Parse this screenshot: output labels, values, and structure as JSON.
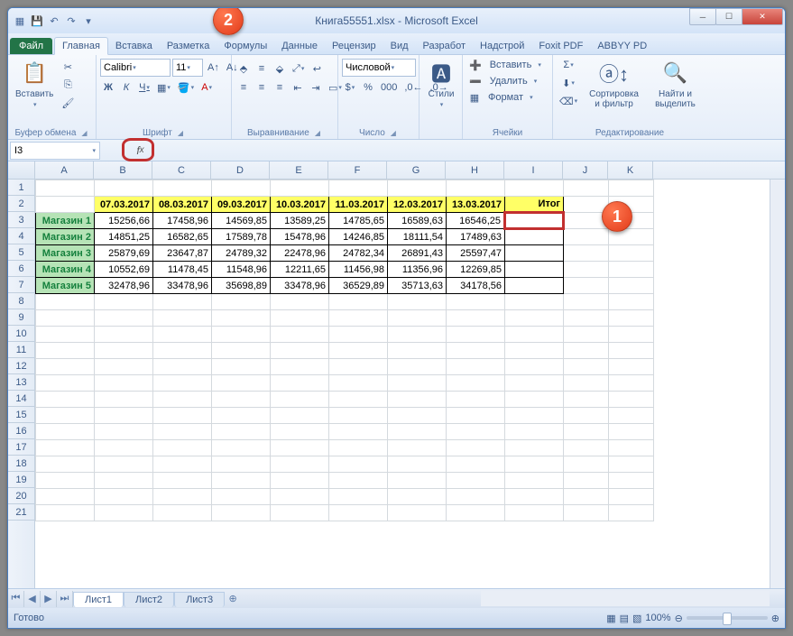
{
  "title": "Книга55551.xlsx - Microsoft Excel",
  "tabs": {
    "file": "Файл",
    "home": "Главная",
    "insert": "Вставка",
    "layout": "Разметка",
    "formulas": "Формулы",
    "data": "Данные",
    "review": "Рецензир",
    "view": "Вид",
    "dev": "Разработ",
    "addins": "Надстрой",
    "foxit": "Foxit PDF",
    "abbyy": "ABBYY PD"
  },
  "groups": {
    "clipboard": "Буфер обмена",
    "font": "Шрифт",
    "align": "Выравнивание",
    "number": "Число",
    "styles": "Стили",
    "cells": "Ячейки",
    "editing": "Редактирование"
  },
  "ribbon": {
    "paste": "Вставить",
    "font_name": "Calibri",
    "font_size": "11",
    "number_format": "Числовой",
    "insert": "Вставить",
    "delete": "Удалить",
    "format": "Формат",
    "styles": "Стили",
    "sort": "Сортировка и фильтр",
    "find": "Найти и выделить"
  },
  "namebox": "I3",
  "cols": [
    "A",
    "B",
    "C",
    "D",
    "E",
    "F",
    "G",
    "H",
    "I",
    "J",
    "K"
  ],
  "rows": [
    "1",
    "2",
    "3",
    "4",
    "5",
    "6",
    "7",
    "8",
    "9",
    "10",
    "11",
    "12",
    "13",
    "14",
    "15",
    "16",
    "17",
    "18",
    "19",
    "20",
    "21"
  ],
  "table": {
    "headers": [
      "07.03.2017",
      "08.03.2017",
      "09.03.2017",
      "10.03.2017",
      "11.03.2017",
      "12.03.2017",
      "13.03.2017",
      "Итог"
    ],
    "rows": [
      {
        "label": "Магазин 1",
        "v": [
          "15256,66",
          "17458,96",
          "14569,85",
          "13589,25",
          "14785,65",
          "16589,63",
          "16546,25"
        ]
      },
      {
        "label": "Магазин 2",
        "v": [
          "14851,25",
          "16582,65",
          "17589,78",
          "15478,96",
          "14246,85",
          "18111,54",
          "17489,63"
        ]
      },
      {
        "label": "Магазин 3",
        "v": [
          "25879,69",
          "23647,87",
          "24789,32",
          "22478,96",
          "24782,34",
          "26891,43",
          "25597,47"
        ]
      },
      {
        "label": "Магазин 4",
        "v": [
          "10552,69",
          "11478,45",
          "11548,96",
          "12211,65",
          "11456,98",
          "11356,96",
          "12269,85"
        ]
      },
      {
        "label": "Магазин 5",
        "v": [
          "32478,96",
          "33478,96",
          "35698,89",
          "33478,96",
          "36529,89",
          "35713,63",
          "34178,56"
        ]
      }
    ]
  },
  "sheets": [
    "Лист1",
    "Лист2",
    "Лист3"
  ],
  "status": "Готово",
  "zoom": "100%",
  "callouts": {
    "c1": "1",
    "c2": "2"
  }
}
